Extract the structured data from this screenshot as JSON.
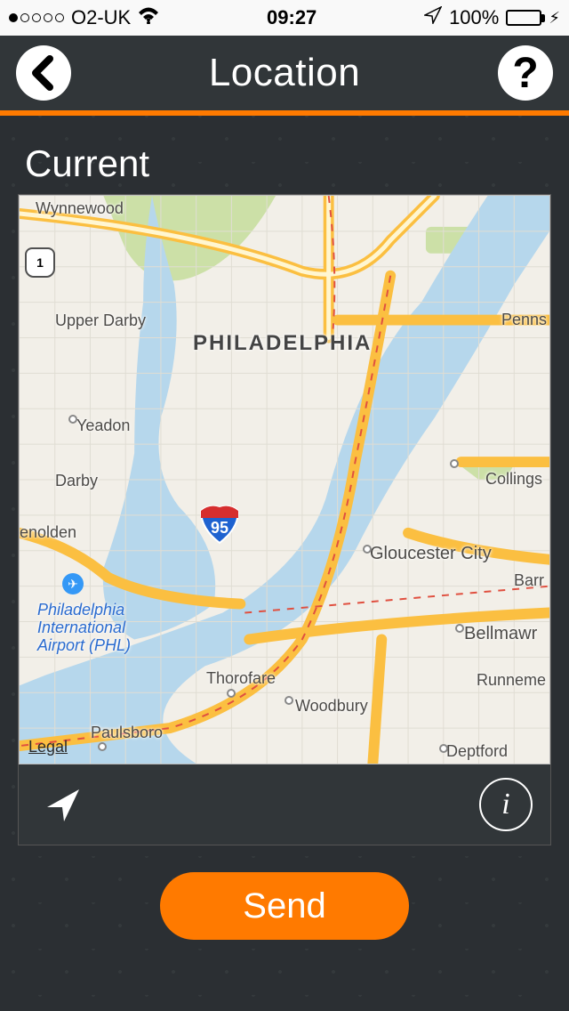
{
  "status_bar": {
    "carrier": "O2-UK",
    "time": "09:27",
    "battery": "100%",
    "signal_filled": 1,
    "signal_total": 5
  },
  "nav": {
    "title": "Location"
  },
  "section": {
    "label": "Current"
  },
  "map": {
    "legal": "Legal",
    "center_label": "PHILADELPHIA",
    "interstate": "95",
    "us_route": "1",
    "places": {
      "wynnewood": "Wynnewood",
      "upper_darby": "Upper Darby",
      "yeadon": "Yeadon",
      "darby": "Darby",
      "enolden": "enolden",
      "paulsboro": "Paulsboro",
      "thorofare": "Thorofare",
      "woodbury": "Woodbury",
      "deptford": "Deptford",
      "gloucester_city": "Gloucester City",
      "collings": "Collings",
      "penns": "Penns",
      "bellmawr": "Bellmawr",
      "barr": "Barr",
      "runneme": "Runneme",
      "phl": "Philadelphia\nInternational\nAirport (PHL)"
    }
  },
  "actions": {
    "send": "Send"
  }
}
